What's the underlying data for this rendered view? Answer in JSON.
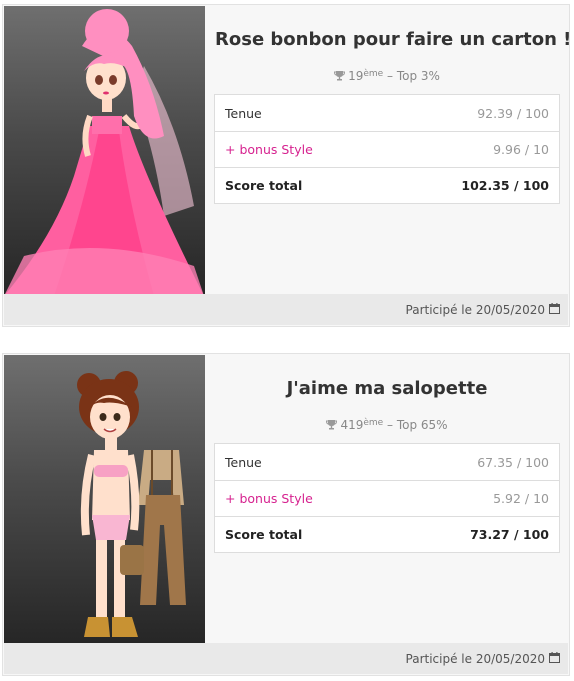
{
  "entries": [
    {
      "title": "Rose bonbon pour faire un carton !",
      "rank_number": "19",
      "rank_suffix": "ème",
      "rank_top": " – Top 3%",
      "scores": [
        {
          "label": "Tenue",
          "value": "92.39 / 100"
        },
        {
          "label": "+ bonus Style",
          "value": "9.96 / 10"
        },
        {
          "label": "Score total",
          "value": "102.35 / 100"
        }
      ],
      "participated": "Participé le 20/05/2020",
      "trophy_icon": "trophy-icon",
      "calendar_icon": "calendar-icon"
    },
    {
      "title": "J'aime ma salopette",
      "rank_number": "419",
      "rank_suffix": "ème",
      "rank_top": " – Top 65%",
      "scores": [
        {
          "label": "Tenue",
          "value": "67.35 / 100"
        },
        {
          "label": "+ bonus Style",
          "value": "5.92 / 10"
        },
        {
          "label": "Score total",
          "value": "73.27 / 100"
        }
      ],
      "participated": "Participé le 20/05/2020",
      "trophy_icon": "trophy-icon",
      "calendar_icon": "calendar-icon"
    }
  ],
  "colors": {
    "bonus_accent": "#d6228f",
    "card_bg": "#f7f7f7",
    "footer_bg": "#e9e9e9"
  }
}
